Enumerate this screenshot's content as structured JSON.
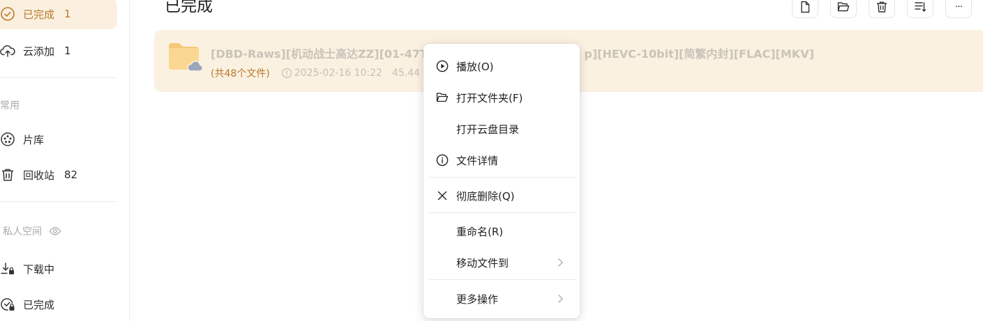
{
  "sidebar": {
    "top_items": [
      {
        "label": "已完成",
        "count": "1",
        "icon": "check-circle-icon",
        "active": true
      },
      {
        "label": "云添加",
        "count": "1",
        "icon": "cloud-upload-icon",
        "active": false
      }
    ],
    "common_label": "常用",
    "common_items": [
      {
        "label": "片库",
        "count": "",
        "icon": "film-reel-icon"
      },
      {
        "label": "回收站",
        "count": "82",
        "icon": "trash-icon"
      }
    ],
    "private_label": "私人空间",
    "private_items": [
      {
        "label": "下载中",
        "icon": "download-lock-icon"
      },
      {
        "label": "已完成",
        "icon": "check-lock-icon"
      }
    ]
  },
  "header": {
    "title": "已完成",
    "toolbar_icons": [
      "new-file-icon",
      "open-folder-icon",
      "trash-icon",
      "sort-icon",
      "more-icon"
    ],
    "more_label": "···"
  },
  "file": {
    "name": "[DBD-Raws][机动战士高达ZZ][01-47TV",
    "name_tail": "p][HEVC-10bit][简繁内封][FLAC][MKV]",
    "count": "(共48个文件)",
    "date": "2025-02-16 10:22",
    "size": "45.44"
  },
  "context_menu": {
    "items": [
      {
        "label": "播放(O)",
        "icon": "play-circle-icon"
      },
      {
        "label": "打开文件夹(F)",
        "icon": "folder-open-icon"
      },
      {
        "label": "打开云盘目录",
        "icon": ""
      },
      {
        "label": "文件详情",
        "icon": "info-circle-icon"
      },
      {
        "label": "彻底删除(Q)",
        "icon": "close-icon"
      },
      {
        "label": "重命名(R)",
        "icon": ""
      },
      {
        "label": "移动文件到",
        "icon": "",
        "submenu": true
      },
      {
        "label": "更多操作",
        "icon": "",
        "submenu": true
      }
    ]
  },
  "colors": {
    "accent": "#b8792a",
    "active_bg": "#fbf0df",
    "row_bg": "#fbf1e1"
  }
}
